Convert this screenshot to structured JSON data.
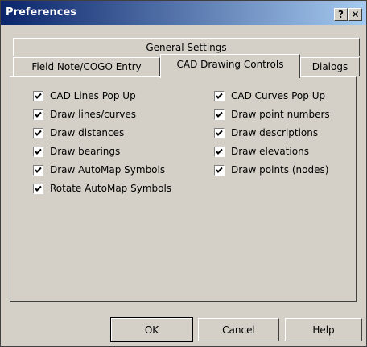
{
  "window": {
    "title": "Preferences",
    "help_btn": "?",
    "close_btn": "✕"
  },
  "tabs": {
    "row1": [
      "General Settings"
    ],
    "row2": [
      "Field Note/COGO Entry",
      "CAD Drawing Controls",
      "Dialogs"
    ],
    "active": "CAD Drawing Controls"
  },
  "left_options": [
    {
      "label": "CAD Lines Pop Up",
      "checked": true
    },
    {
      "label": "Draw lines/curves",
      "checked": true
    },
    {
      "label": "Draw distances",
      "checked": true
    },
    {
      "label": "Draw bearings",
      "checked": true
    },
    {
      "label": "Draw AutoMap Symbols",
      "checked": true
    },
    {
      "label": "Rotate AutoMap Symbols",
      "checked": true
    }
  ],
  "right_options": [
    {
      "label": "CAD Curves Pop Up",
      "checked": true
    },
    {
      "label": "Draw point numbers",
      "checked": true
    },
    {
      "label": "Draw descriptions",
      "checked": true
    },
    {
      "label": "Draw elevations",
      "checked": true
    },
    {
      "label": "Draw points (nodes)",
      "checked": true
    }
  ],
  "buttons": {
    "ok": "OK",
    "cancel": "Cancel",
    "help": "Help"
  }
}
